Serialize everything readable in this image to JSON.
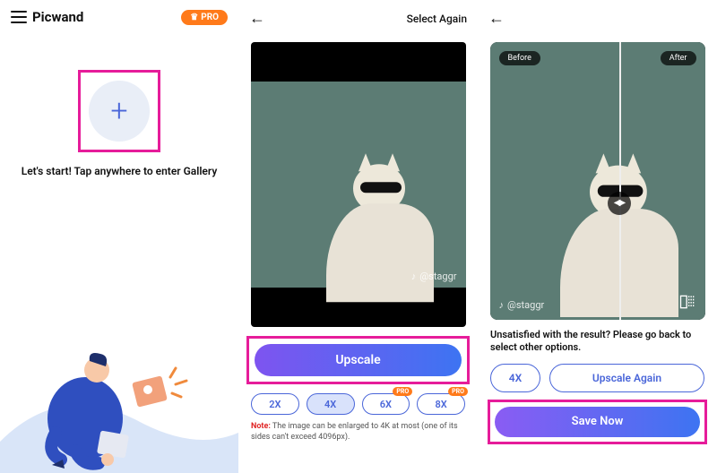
{
  "panel1": {
    "app_name": "Picwand",
    "pro_label": "PRO",
    "start_text": "Let's start! Tap anywhere to enter Gallery"
  },
  "panel2": {
    "select_again": "Select Again",
    "watermark": "@staggr",
    "upscale_label": "Upscale",
    "scales": [
      "2X",
      "4X",
      "6X",
      "8X"
    ],
    "active_scale_index": 1,
    "pro_tag": "PRO",
    "note_prefix": "Note:",
    "note_text": " The image can be enlarged to 4K at most (one of its sides can't exceed 4096px)."
  },
  "panel3": {
    "before_label": "Before",
    "after_label": "After",
    "watermark": "@staggr",
    "unsatisfied": "Unsatisfied with the result? Please go back to select other options.",
    "scale_label": "4X",
    "upscale_again": "Upscale Again",
    "save_label": "Save Now"
  }
}
